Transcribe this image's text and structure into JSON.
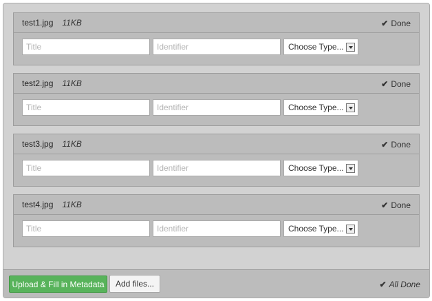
{
  "files": [
    {
      "name": "test1.jpg",
      "size": "11KB",
      "status": "Done"
    },
    {
      "name": "test2.jpg",
      "size": "11KB",
      "status": "Done"
    },
    {
      "name": "test3.jpg",
      "size": "11KB",
      "status": "Done"
    },
    {
      "name": "test4.jpg",
      "size": "11KB",
      "status": "Done"
    }
  ],
  "fields": {
    "title_placeholder": "Title",
    "identifier_placeholder": "Identifier",
    "type_selected": "Choose Type..."
  },
  "footer": {
    "upload_label": "Upload & Fill in Metadata",
    "add_label": "Add files...",
    "all_done": "All Done"
  },
  "icons": {
    "status": "check-icon",
    "select": "chevron-down-icon"
  },
  "colors": {
    "upload_button": "#58b35b",
    "panel": "#bcbcbc",
    "background": "#d2d2d2"
  }
}
